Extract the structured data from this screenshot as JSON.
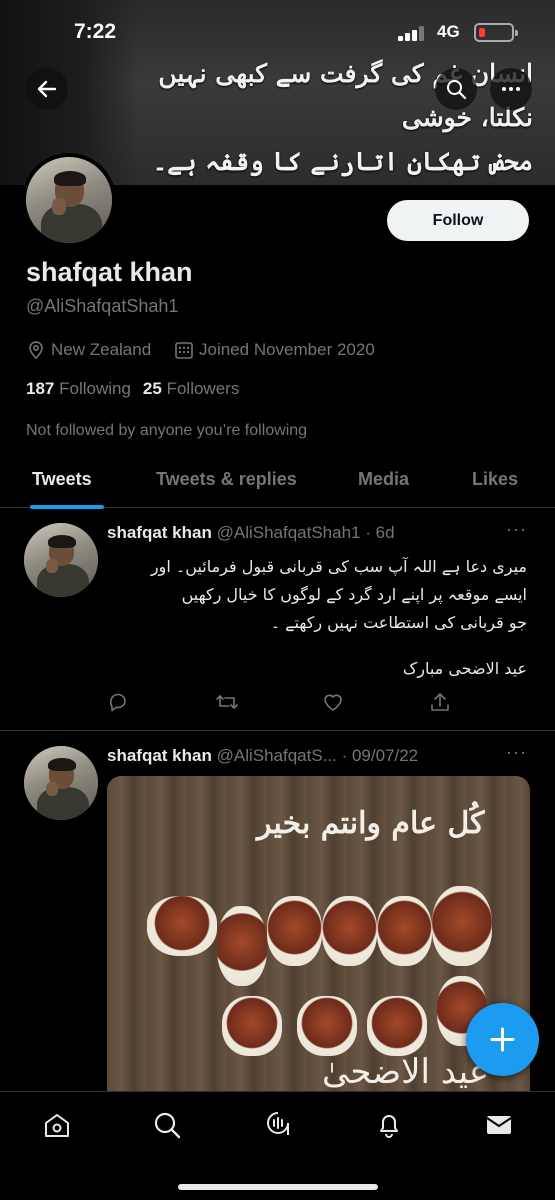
{
  "status_bar": {
    "time": "7:22",
    "network": "4G"
  },
  "banner": {
    "quote_line1": "انسان غم کی گرفت سے کبھی نہیں نکلتا، خوشی",
    "quote_line2": "محض تھکان اتارنے کا وقفہ ہے۔"
  },
  "profile": {
    "follow_label": "Follow",
    "display_name": "shafqat khan",
    "handle": "@AliShafqatShah1",
    "location": "New Zealand",
    "joined": "Joined November 2020",
    "following_count": "187",
    "following_label": "Following",
    "followers_count": "25",
    "followers_label": "Followers",
    "not_followed_text": "Not followed by anyone you’re following"
  },
  "tabs": [
    {
      "label": "Tweets",
      "active": true
    },
    {
      "label": "Tweets & replies",
      "active": false
    },
    {
      "label": "Media",
      "active": false
    },
    {
      "label": "Likes",
      "active": false
    }
  ],
  "tweets": [
    {
      "name": "shafqat khan",
      "handle_time": "@AliShafqatShah1 · 6d",
      "line1": "میری دعا ہے اللہ آپ سب کی قربانی قبول فرمائیں۔ اور",
      "line2": "ایسے موقعہ پر اپنے ارد گرد کے لوگوں کا خیال رکھیں",
      "line3": "جو قربانی کی استطاعت نہیں رکھتے ۔",
      "line4": "عید الاضحی مبارک"
    },
    {
      "name": "shafqat khan",
      "handle_time": "@AliShafqatS... · 09/07/22",
      "media_title": "کُل عام وانتم بخیر",
      "media_footer": "عید الاضحیٰ"
    }
  ],
  "colors": {
    "accent": "#1d9bf0",
    "background": "#000000",
    "muted": "#71767b",
    "text": "#e7e9ea"
  }
}
